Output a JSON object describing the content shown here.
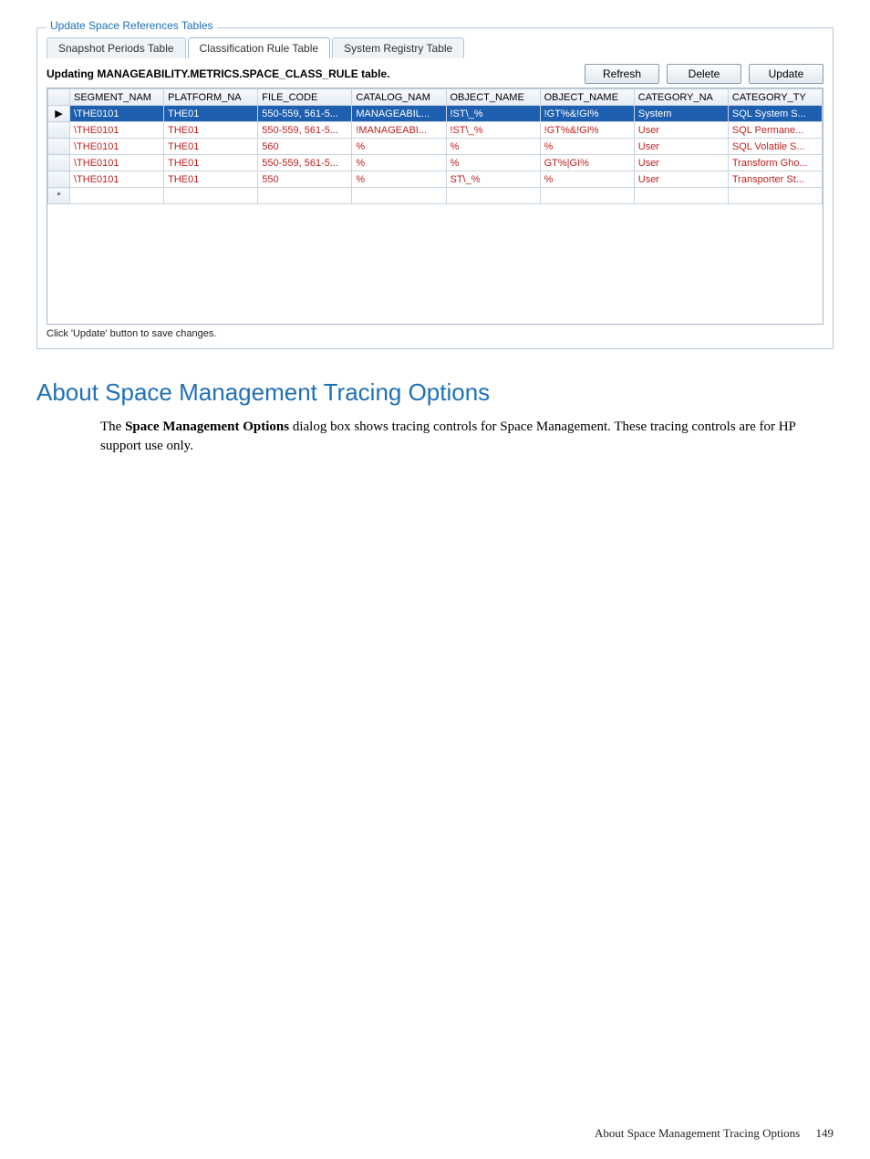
{
  "panel": {
    "title": "Update Space References Tables",
    "tabs": [
      "Snapshot Periods Table",
      "Classification Rule Table",
      "System Registry Table"
    ],
    "active_tab": 1,
    "status": "Updating MANAGEABILITY.METRICS.SPACE_CLASS_RULE table.",
    "buttons": {
      "refresh": "Refresh",
      "delete": "Delete",
      "update": "Update"
    },
    "hint": "Click 'Update' button to save changes."
  },
  "grid": {
    "columns": [
      "SEGMENT_NAM",
      "PLATFORM_NA",
      "FILE_CODE",
      "CATALOG_NAM",
      "OBJECT_NAME",
      "OBJECT_NAME",
      "CATEGORY_NA",
      "CATEGORY_TY"
    ],
    "row_markers": {
      "selected": "▶",
      "new": "*"
    },
    "rows": [
      {
        "selected": true,
        "cells": [
          "\\THE0101",
          "THE01",
          "550-559, 561-5...",
          "MANAGEABIL...",
          "!ST\\_%",
          "!GT%&!GI%",
          "System",
          "SQL System S..."
        ]
      },
      {
        "selected": false,
        "cells": [
          "\\THE0101",
          "THE01",
          "550-559, 561-5...",
          "!MANAGEABI...",
          "!ST\\_%",
          "!GT%&!GI%",
          "User",
          "SQL Permane..."
        ]
      },
      {
        "selected": false,
        "cells": [
          "\\THE0101",
          "THE01",
          "560",
          "%",
          "%",
          "%",
          "User",
          "SQL Volatile S..."
        ]
      },
      {
        "selected": false,
        "cells": [
          "\\THE0101",
          "THE01",
          "550-559, 561-5...",
          "%",
          "%",
          "GT%|GI%",
          "User",
          "Transform Gho..."
        ]
      },
      {
        "selected": false,
        "cells": [
          "\\THE0101",
          "THE01",
          "550",
          "%",
          "ST\\_%",
          "%",
          "User",
          "Transporter St..."
        ]
      }
    ]
  },
  "article": {
    "heading": "About Space Management Tracing Options",
    "para_pre": "The ",
    "para_bold": "Space Management Options",
    "para_post": " dialog box shows tracing controls for Space Management. These tracing controls are for HP support use only."
  },
  "footer": {
    "label": "About Space Management Tracing Options",
    "page": "149"
  }
}
